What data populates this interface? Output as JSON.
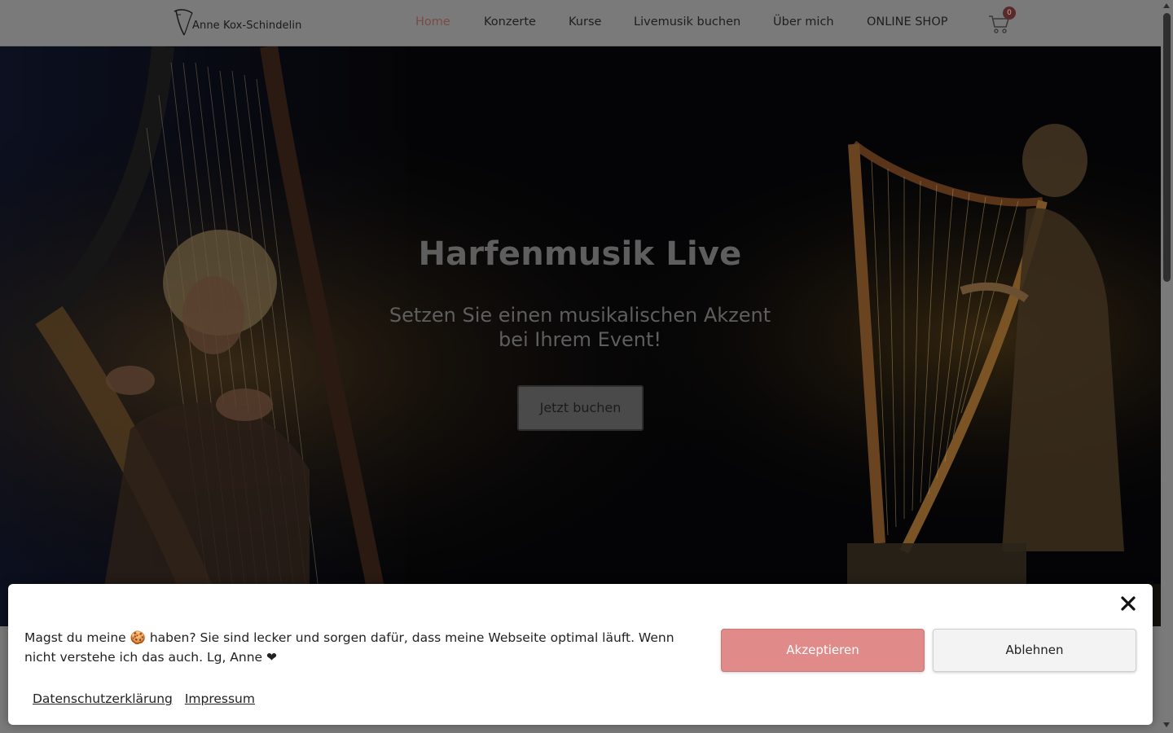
{
  "header": {
    "logo_text": "Anne Kox-Schindelin",
    "nav": [
      {
        "label": "Home",
        "active": true
      },
      {
        "label": "Konzerte"
      },
      {
        "label": "Kurse"
      },
      {
        "label": "Livemusik buchen"
      },
      {
        "label": "Über mich"
      },
      {
        "label": "ONLINE SHOP"
      }
    ],
    "cart_count": "0",
    "cart_icon": "shopping-cart-icon"
  },
  "hero": {
    "title": "Harfenmusik Live",
    "subtitle": "Setzen Sie einen musikalischen Akzent bei Ihrem Event!",
    "button": "Jetzt buchen"
  },
  "cookie": {
    "message": "Magst du meine 🍪 haben? Sie sind lecker und sorgen dafür, dass meine Webseite optimal läuft. Wenn nicht verstehe ich das auch. Lg, Anne ❤",
    "accept": "Akzeptieren",
    "decline": "Ablehnen",
    "links": {
      "privacy": "Datenschutzerklärung",
      "imprint": "Impressum"
    },
    "close_icon": "close-icon"
  },
  "colors": {
    "accent": "#e08a8a",
    "nav_active": "#7a4a44",
    "header_bg": "#7a7a7a"
  }
}
